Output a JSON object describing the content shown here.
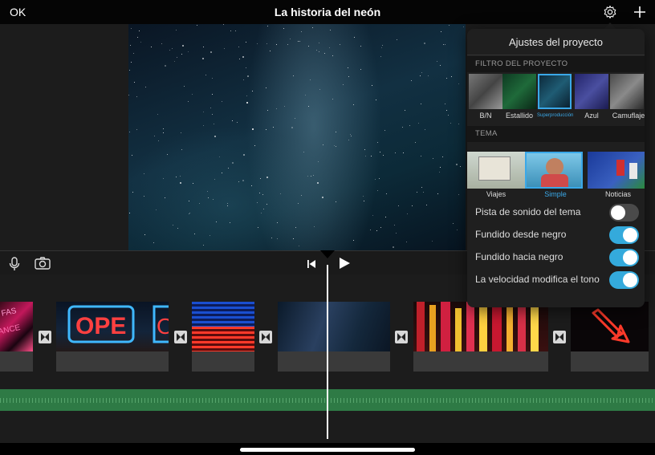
{
  "header": {
    "ok_label": "OK",
    "title": "La historia del neón"
  },
  "popover": {
    "title": "Ajustes del proyecto",
    "filter_section": "FILTRO DEL PROYECTO",
    "filters": [
      "B/N",
      "Estallido",
      "Superproducción",
      "Azul",
      "Camuflaje"
    ],
    "selected_filter": "Superproducción",
    "theme_section": "TEMA",
    "themes": [
      "Viajes",
      "Simple",
      "Noticias"
    ],
    "selected_theme": "Simple",
    "settings": [
      {
        "label": "Pista de sonido del tema",
        "on": false
      },
      {
        "label": "Fundido desde negro",
        "on": true
      },
      {
        "label": "Fundido hacia negro",
        "on": true
      },
      {
        "label": "La velocidad modifica el tono",
        "on": true
      }
    ]
  },
  "timeline": {
    "clips": [
      "neon-sign-fas",
      "neon-open-sign",
      "neon-blue-red-lights",
      "starry-sky",
      "city-neon-signs",
      "neon-arrow"
    ]
  },
  "colors": {
    "accent": "#34aadc",
    "audio_track": "#2e7a45",
    "selected_border": "#3aa8e8"
  }
}
